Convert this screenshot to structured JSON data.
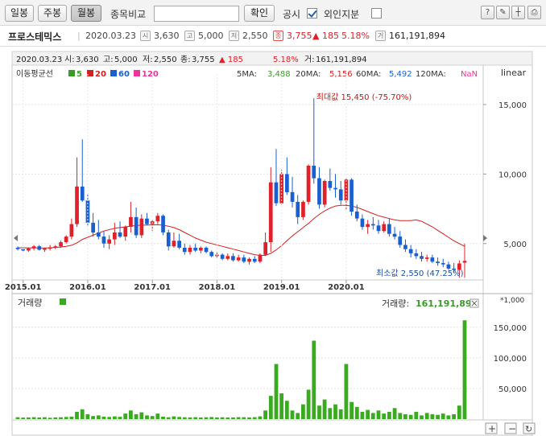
{
  "toolbar": {
    "day_label": "일봉",
    "week_label": "주봉",
    "month_label": "월봉",
    "compare_label": "종목비교",
    "confirm_label": "확인",
    "disclosure_label": "공시",
    "disclosure_checked": true,
    "foreign_label": "외인지분",
    "foreign_checked": false
  },
  "info": {
    "stock_name": "프로스테믹스",
    "date": "2020.03.23",
    "open_tag": "시",
    "open": "3,630",
    "high_tag": "고",
    "high": "5,000",
    "low_tag": "저",
    "low": "2,550",
    "close_tag": "종",
    "close": "3,755",
    "change": "▲ 185",
    "change_pct": "5.18%",
    "vol_tag": "거",
    "volume": "161,191,894"
  },
  "chart_header": {
    "date": "2020.03.23",
    "open_label": "시:",
    "open": "3,630",
    "high_label": "고:",
    "high": "5,000",
    "low_label": "저:",
    "low": "2,550",
    "close_label": "종:",
    "close": "3,755",
    "change": "▲ 185",
    "change_pct": "5.18%",
    "vol_label": "거:",
    "volume": "161,191,894"
  },
  "ma_legend": {
    "title": "이동평균선",
    "periods": [
      "5",
      "20",
      "60",
      "120"
    ],
    "colors": [
      "#3a9a2a",
      "#d42020",
      "#1a5fd0",
      "#ee3399"
    ],
    "ma5_label": "5MA:",
    "ma5": "3,488",
    "ma20_label": "20MA:",
    "ma20": "5,156",
    "ma60_label": "60MA:",
    "ma60": "5,492",
    "ma120_label": "120MA:",
    "ma120": "NaN"
  },
  "scale_label": "linear",
  "max_annotation": "최대값 15,450 (-75.70%)",
  "min_annotation": "최소값 2,550 (47.25%)",
  "volume_panel": {
    "title": "거래량",
    "color": "#3aaa20",
    "last_label": "거래량:",
    "last_value": "161,191,894",
    "multiplier": "*1,000",
    "y_ticks": [
      "150,000",
      "100,000",
      "50,000"
    ]
  },
  "colors": {
    "up": "#e0202a",
    "down": "#1a5fd0",
    "ma20": "#d42020",
    "ma5": "#3a9a2a",
    "volume": "#3aaa20"
  },
  "chart_data": [
    {
      "type": "candlestick",
      "title": "",
      "x_ticks": [
        "2015.01",
        "2016.01",
        "2017.01",
        "2018.01",
        "2019.01",
        "2020.01"
      ],
      "y_ticks": [
        "15,000",
        "10,000",
        "5,000"
      ],
      "ylim": [
        2500,
        16500
      ],
      "series": [
        {
          "name": "price",
          "values": [
            {
              "o": 4700,
              "h": 4800,
              "l": 4500,
              "c": 4600
            },
            {
              "o": 4600,
              "h": 4700,
              "l": 4400,
              "c": 4500
            },
            {
              "o": 4500,
              "h": 4700,
              "l": 4400,
              "c": 4650
            },
            {
              "o": 4650,
              "h": 4900,
              "l": 4500,
              "c": 4800
            },
            {
              "o": 4800,
              "h": 4900,
              "l": 4500,
              "c": 4550
            },
            {
              "o": 4550,
              "h": 4700,
              "l": 4400,
              "c": 4650
            },
            {
              "o": 4650,
              "h": 4900,
              "l": 4500,
              "c": 4700
            },
            {
              "o": 4700,
              "h": 4900,
              "l": 4600,
              "c": 4800
            },
            {
              "o": 4800,
              "h": 5200,
              "l": 4700,
              "c": 5100
            },
            {
              "o": 5100,
              "h": 5600,
              "l": 5000,
              "c": 5500
            },
            {
              "o": 5500,
              "h": 6800,
              "l": 5300,
              "c": 6400
            },
            {
              "o": 6400,
              "h": 11200,
              "l": 6200,
              "c": 9100
            },
            {
              "o": 9100,
              "h": 12500,
              "l": 8000,
              "c": 8100
            },
            {
              "o": 8100,
              "h": 8600,
              "l": 6200,
              "c": 6500
            },
            {
              "o": 6500,
              "h": 7200,
              "l": 5500,
              "c": 5800
            },
            {
              "o": 5800,
              "h": 6700,
              "l": 5300,
              "c": 5500
            },
            {
              "o": 5500,
              "h": 5900,
              "l": 4700,
              "c": 5000
            },
            {
              "o": 5000,
              "h": 5600,
              "l": 4600,
              "c": 5300
            },
            {
              "o": 5300,
              "h": 6500,
              "l": 4900,
              "c": 5800
            },
            {
              "o": 5800,
              "h": 6600,
              "l": 5400,
              "c": 5500
            },
            {
              "o": 5500,
              "h": 6300,
              "l": 5200,
              "c": 6200
            },
            {
              "o": 6200,
              "h": 8000,
              "l": 5800,
              "c": 6900
            },
            {
              "o": 6900,
              "h": 7600,
              "l": 5400,
              "c": 5600
            },
            {
              "o": 5600,
              "h": 7100,
              "l": 5400,
              "c": 6800
            },
            {
              "o": 6800,
              "h": 7200,
              "l": 6300,
              "c": 6400
            },
            {
              "o": 6400,
              "h": 6700,
              "l": 5900,
              "c": 6600
            },
            {
              "o": 6600,
              "h": 7200,
              "l": 6400,
              "c": 7000
            },
            {
              "o": 7000,
              "h": 7100,
              "l": 5600,
              "c": 5800
            },
            {
              "o": 5800,
              "h": 6000,
              "l": 4500,
              "c": 4800
            },
            {
              "o": 4800,
              "h": 5800,
              "l": 4700,
              "c": 5200
            },
            {
              "o": 5200,
              "h": 5700,
              "l": 4600,
              "c": 4700
            },
            {
              "o": 4700,
              "h": 5000,
              "l": 4200,
              "c": 4400
            },
            {
              "o": 4400,
              "h": 4900,
              "l": 4200,
              "c": 4700
            },
            {
              "o": 4700,
              "h": 5000,
              "l": 4400,
              "c": 4500
            },
            {
              "o": 4500,
              "h": 4800,
              "l": 4300,
              "c": 4700
            },
            {
              "o": 4700,
              "h": 4800,
              "l": 4300,
              "c": 4400
            },
            {
              "o": 4400,
              "h": 4500,
              "l": 4000,
              "c": 4100
            },
            {
              "o": 4100,
              "h": 4400,
              "l": 3900,
              "c": 4200
            },
            {
              "o": 4200,
              "h": 4300,
              "l": 3800,
              "c": 3900
            },
            {
              "o": 3900,
              "h": 4300,
              "l": 3800,
              "c": 4100
            },
            {
              "o": 4100,
              "h": 4300,
              "l": 3700,
              "c": 3800
            },
            {
              "o": 3800,
              "h": 4200,
              "l": 3700,
              "c": 4000
            },
            {
              "o": 4000,
              "h": 4200,
              "l": 3600,
              "c": 3700
            },
            {
              "o": 3700,
              "h": 4000,
              "l": 3500,
              "c": 3900
            },
            {
              "o": 3900,
              "h": 4100,
              "l": 3600,
              "c": 3700
            },
            {
              "o": 3700,
              "h": 4300,
              "l": 3600,
              "c": 4200
            },
            {
              "o": 4200,
              "h": 5800,
              "l": 4100,
              "c": 5100
            },
            {
              "o": 5100,
              "h": 10500,
              "l": 4400,
              "c": 9400
            },
            {
              "o": 9400,
              "h": 11800,
              "l": 7700,
              "c": 7900
            },
            {
              "o": 7900,
              "h": 10300,
              "l": 7800,
              "c": 10000
            },
            {
              "o": 10000,
              "h": 11200,
              "l": 8500,
              "c": 8700
            },
            {
              "o": 8700,
              "h": 9800,
              "l": 7600,
              "c": 8000
            },
            {
              "o": 8000,
              "h": 8500,
              "l": 6400,
              "c": 6900
            },
            {
              "o": 6900,
              "h": 8100,
              "l": 6700,
              "c": 8000
            },
            {
              "o": 8000,
              "h": 10700,
              "l": 7800,
              "c": 10600
            },
            {
              "o": 10600,
              "h": 15450,
              "l": 9300,
              "c": 9700
            },
            {
              "o": 9700,
              "h": 10500,
              "l": 7500,
              "c": 7800
            },
            {
              "o": 7800,
              "h": 9600,
              "l": 7600,
              "c": 9500
            },
            {
              "o": 9500,
              "h": 10400,
              "l": 8800,
              "c": 9000
            },
            {
              "o": 9000,
              "h": 10000,
              "l": 8300,
              "c": 8900
            },
            {
              "o": 8900,
              "h": 9500,
              "l": 7800,
              "c": 8100
            },
            {
              "o": 8100,
              "h": 9700,
              "l": 7400,
              "c": 9600
            },
            {
              "o": 9600,
              "h": 9700,
              "l": 7000,
              "c": 7300
            },
            {
              "o": 7300,
              "h": 7800,
              "l": 6600,
              "c": 6800
            },
            {
              "o": 6800,
              "h": 7100,
              "l": 6000,
              "c": 6200
            },
            {
              "o": 6200,
              "h": 6700,
              "l": 5700,
              "c": 6400
            },
            {
              "o": 6400,
              "h": 6900,
              "l": 6000,
              "c": 6300
            },
            {
              "o": 6300,
              "h": 6700,
              "l": 5700,
              "c": 5900
            },
            {
              "o": 5900,
              "h": 6600,
              "l": 5800,
              "c": 6400
            },
            {
              "o": 6400,
              "h": 6800,
              "l": 5500,
              "c": 5700
            },
            {
              "o": 5700,
              "h": 6200,
              "l": 5300,
              "c": 5500
            },
            {
              "o": 5500,
              "h": 5900,
              "l": 4700,
              "c": 4900
            },
            {
              "o": 4900,
              "h": 5300,
              "l": 4400,
              "c": 4600
            },
            {
              "o": 4600,
              "h": 4900,
              "l": 4000,
              "c": 4300
            },
            {
              "o": 4300,
              "h": 4600,
              "l": 3900,
              "c": 4100
            },
            {
              "o": 4100,
              "h": 4400,
              "l": 3700,
              "c": 3900
            },
            {
              "o": 3900,
              "h": 4200,
              "l": 3700,
              "c": 4000
            },
            {
              "o": 4000,
              "h": 4200,
              "l": 3600,
              "c": 3700
            },
            {
              "o": 3700,
              "h": 4000,
              "l": 3400,
              "c": 3600
            },
            {
              "o": 3600,
              "h": 3900,
              "l": 3300,
              "c": 3500
            },
            {
              "o": 3500,
              "h": 3700,
              "l": 3100,
              "c": 3200
            },
            {
              "o": 3200,
              "h": 3600,
              "l": 2900,
              "c": 3100
            },
            {
              "o": 3100,
              "h": 3800,
              "l": 2550,
              "c": 3570
            },
            {
              "o": 3630,
              "h": 5000,
              "l": 2550,
              "c": 3755
            }
          ]
        },
        {
          "name": "20",
          "values": [
            4700,
            4700,
            4690,
            4690,
            4680,
            4680,
            4700,
            4720,
            4750,
            4800,
            4880,
            5050,
            5300,
            5450,
            5600,
            5750,
            5900,
            6000,
            6100,
            6150,
            6200,
            6250,
            6300,
            6320,
            6330,
            6340,
            6350,
            6320,
            6250,
            6150,
            6000,
            5800,
            5600,
            5400,
            5250,
            5100,
            5000,
            4900,
            4800,
            4700,
            4600,
            4500,
            4400,
            4300,
            4200,
            4150,
            4150,
            4300,
            4550,
            4850,
            5200,
            5550,
            5850,
            6150,
            6450,
            6800,
            7100,
            7350,
            7550,
            7700,
            7750,
            7750,
            7700,
            7600,
            7450,
            7300,
            7150,
            7000,
            6900,
            6800,
            6700,
            6650,
            6650,
            6650,
            6700,
            6600,
            6400,
            6200,
            5950,
            5700,
            5450,
            5200,
            5000,
            4800
          ]
        }
      ]
    },
    {
      "type": "bar",
      "title": "",
      "ylabel": "거래량",
      "ylim": [
        0,
        172000
      ],
      "series": [
        {
          "name": "거래량",
          "values": [
            3000,
            2500,
            2800,
            3200,
            2600,
            3000,
            2200,
            2800,
            3000,
            3500,
            4000,
            12000,
            16000,
            8000,
            5000,
            6000,
            4000,
            3500,
            4500,
            3800,
            9000,
            14000,
            8000,
            11000,
            6000,
            5000,
            9000,
            4000,
            3000,
            4500,
            3500,
            3000,
            2800,
            3200,
            2600,
            3000,
            3400,
            2800,
            3000,
            2600,
            2800,
            3200,
            3000,
            2800,
            3200,
            4500,
            14000,
            38000,
            90000,
            42000,
            30000,
            14000,
            10000,
            24000,
            48000,
            128000,
            22000,
            32000,
            18000,
            24000,
            16000,
            90000,
            28000,
            20000,
            12000,
            15000,
            10000,
            14000,
            9000,
            12000,
            18000,
            10000,
            8000,
            7000,
            12000,
            6000,
            10000,
            8000,
            7000,
            9000,
            6000,
            8000,
            22000,
            161192
          ]
        }
      ]
    }
  ]
}
